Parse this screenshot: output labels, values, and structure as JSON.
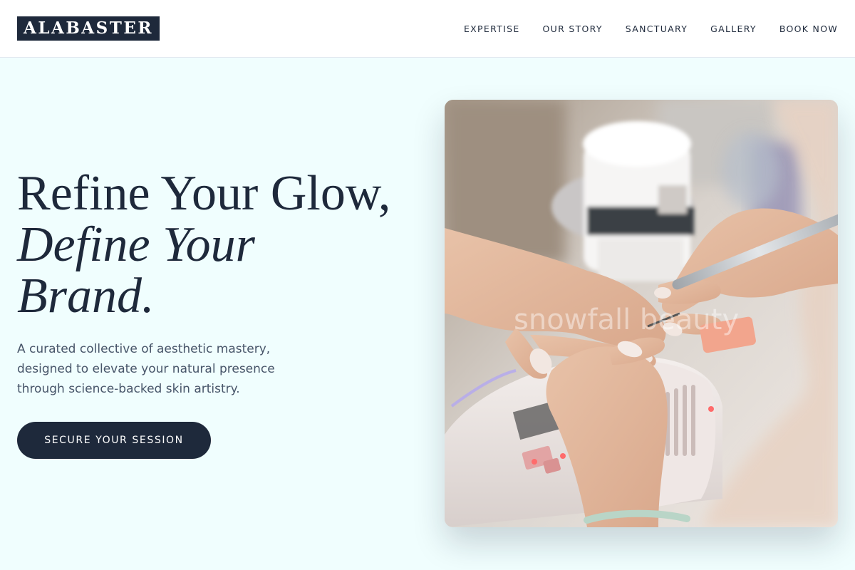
{
  "header": {
    "logo": "ALABASTER",
    "nav": [
      "EXPERTISE",
      "OUR STORY",
      "SANCTUARY",
      "GALLERY",
      "BOOK NOW"
    ]
  },
  "hero": {
    "title_line1": "Refine Your Glow,",
    "title_line2": "Define Your",
    "title_line3": "Brand.",
    "description": "A curated collective of aesthetic mastery, designed to elevate your natural presence through science-backed skin artistry.",
    "cta_label": "SECURE YOUR SESSION"
  },
  "image": {
    "watermark": "snowfall beauty"
  },
  "colors": {
    "brand": "#1e293b",
    "background": "#f0fefe",
    "text_muted": "#475569"
  }
}
